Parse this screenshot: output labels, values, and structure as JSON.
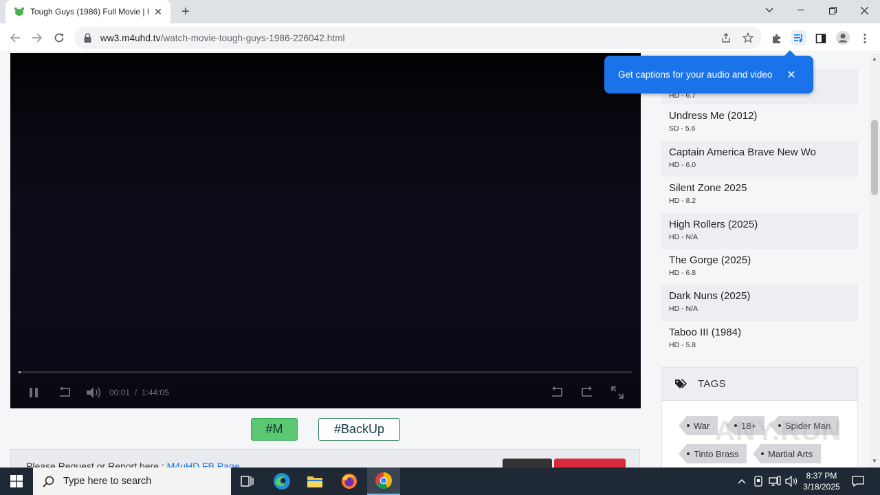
{
  "browser": {
    "tab_title": "Tough Guys (1986) Full Movie | N",
    "url_host": "ww3.m4uhd.tv",
    "url_path": "/watch-movie-tough-guys-1986-226042.html"
  },
  "player": {
    "current_time": "00:01",
    "separator": "/",
    "duration": "1:44:05",
    "progress_fraction": 0.003
  },
  "servers": [
    {
      "label": "#M",
      "active": true
    },
    {
      "label": "#BackUp",
      "active": false
    }
  ],
  "report": {
    "text": "Please Request or Report here : ",
    "link": "M4uHD FB Page"
  },
  "sidebar": {
    "movies": [
      {
        "name": "",
        "meta": "HD - 6.7"
      },
      {
        "name": "Undress Me (2012)",
        "meta": "SD - 5.6"
      },
      {
        "name": "Captain America Brave New Wo",
        "meta": "HD - 6.0"
      },
      {
        "name": "Silent Zone 2025",
        "meta": "HD - 8.2"
      },
      {
        "name": "High Rollers (2025)",
        "meta": "HD - N/A"
      },
      {
        "name": "The Gorge (2025)",
        "meta": "HD - 6.8"
      },
      {
        "name": "Dark Nuns (2025)",
        "meta": "HD - N/A"
      },
      {
        "name": "Taboo III (1984)",
        "meta": "HD - 5.8"
      }
    ],
    "tags_title": "TAGS",
    "tags": [
      "War",
      "18+",
      "Spider Man",
      "Tinto Brass",
      "Martial Arts"
    ]
  },
  "toast": {
    "message": "Get captions for your audio and video"
  },
  "watermark": "ANY.RUN",
  "taskbar": {
    "search_placeholder": "Type here to search",
    "time": "8:37 PM",
    "date": "3/18/2025"
  },
  "colors": {
    "chrome_accent": "#1a73e8",
    "server_active": "#5cc772",
    "report_red": "#d62b3a",
    "taskbar": "#1f2935"
  }
}
